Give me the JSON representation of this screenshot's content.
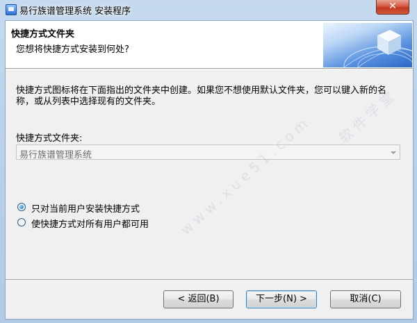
{
  "window": {
    "title": "易行族谱管理系统 安装程序",
    "close_glyph": "✕"
  },
  "header": {
    "title": "快捷方式文件夹",
    "subtitle": "您想将快捷方式安装到何处?",
    "image_icon": "setup-wizard-globe-image"
  },
  "body": {
    "description": "快捷方式图标将在下面指出的文件夹中创建。如果您不想使用默认文件夹，您可以键入新的名称，或从列表中选择现有的文件夹。",
    "folder_label": "快捷方式文件夹:",
    "folder_value": "易行族谱管理系统",
    "radio_options": [
      {
        "label": "只对当前用户安装快捷方式",
        "checked": true
      },
      {
        "label": "使快捷方式对所有用户都可用",
        "checked": false
      }
    ]
  },
  "buttons": {
    "back": "< 返回(B)",
    "next": "下一步(N) >",
    "cancel": "取消(C)"
  },
  "watermark": {
    "text_cn": "软件学堂",
    "text_url": "www.xue51.com"
  },
  "colors": {
    "titlebar": "#c5daee",
    "close_button": "#c13a22",
    "dialog_bg": "#f0f0f0",
    "header_bg": "#ffffff"
  }
}
